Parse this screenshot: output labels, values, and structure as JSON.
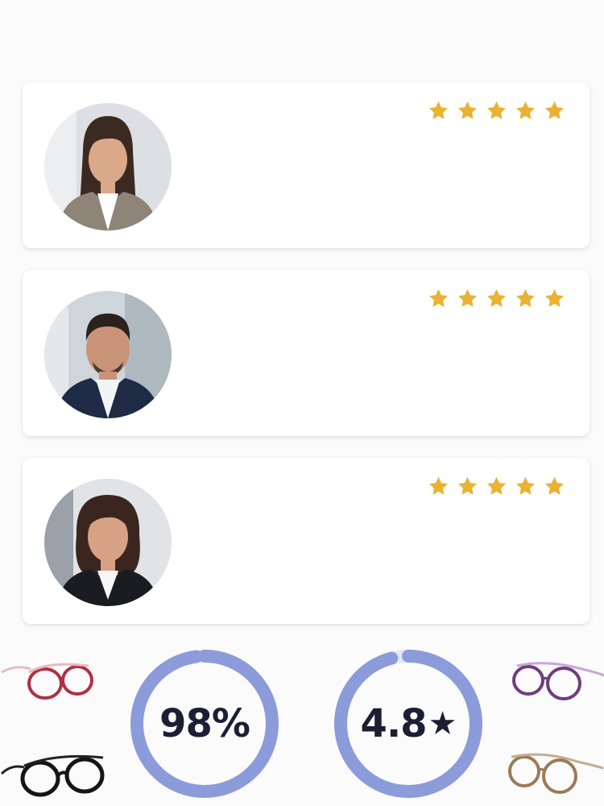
{
  "colors": {
    "star": "#e9b232",
    "ring": "#8c9bd9",
    "ring_track": "#e3e7f6",
    "text": "#1c1f33"
  },
  "testimonials": [
    {
      "avatar": "woman-young-portrait",
      "rating": 5
    },
    {
      "avatar": "man-suit-portrait",
      "rating": 5
    },
    {
      "avatar": "woman-mature-portrait",
      "rating": 5
    }
  ],
  "stats": [
    {
      "value": "98%",
      "fraction": 0.98
    },
    {
      "value": "4.8",
      "suffix": "★",
      "fraction": 0.96
    }
  ],
  "decor": {
    "glasses": [
      "red-glasses-icon",
      "black-glasses-icon",
      "purple-glasses-icon",
      "tan-glasses-icon"
    ]
  }
}
